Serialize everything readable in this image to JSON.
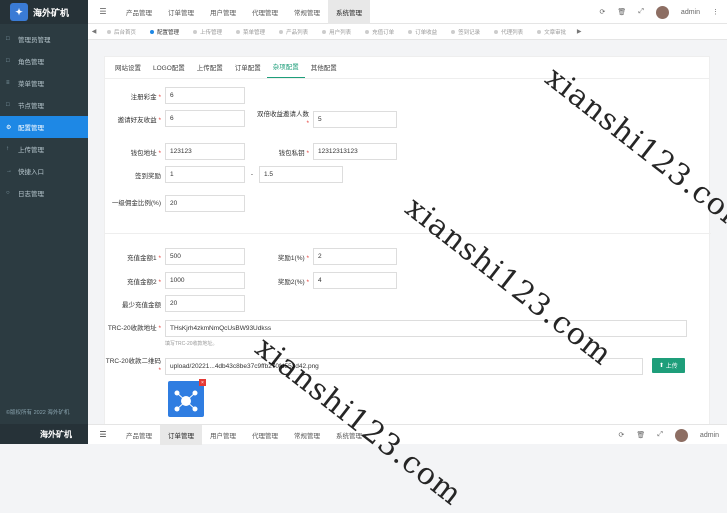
{
  "app": {
    "title": "海外矿机"
  },
  "sidebar": {
    "items": [
      {
        "icon": "□",
        "label": "管理员管理"
      },
      {
        "icon": "□",
        "label": "角色管理"
      },
      {
        "icon": "≡",
        "label": "菜单管理"
      },
      {
        "icon": "□",
        "label": "节点管理"
      },
      {
        "icon": "⚙",
        "label": "配置管理"
      },
      {
        "icon": "↑",
        "label": "上传管理"
      },
      {
        "icon": "→",
        "label": "快捷入口"
      },
      {
        "icon": "○",
        "label": "日志管理"
      }
    ],
    "active_index": 4,
    "copyright": "©版权所有 2022 海外矿机"
  },
  "topbar": {
    "tabs": [
      "产品管理",
      "订单管理",
      "用户管理",
      "代理管理",
      "常规管理",
      "系统管理"
    ],
    "active_index": 5,
    "user": "admin"
  },
  "page_tabs": [
    "后台首页",
    "配置管理",
    "上传管理",
    "菜单管理",
    "产品列表",
    "用户列表",
    "充值订单",
    "订单收益",
    "签到记录",
    "代理列表",
    "文章审批"
  ],
  "page_tabs_active": 1,
  "subtabs": [
    "网站设置",
    "LOGO配置",
    "上传配置",
    "订单配置",
    "杂项配置",
    "其他配置"
  ],
  "subtabs_active": 4,
  "form": {
    "register_bonus": {
      "label": "注册彩金",
      "value": "6"
    },
    "invite_income": {
      "label": "邀请好友收益",
      "value": "6"
    },
    "double_income_invites": {
      "label": "双倍收益邀请人数",
      "value": "5"
    },
    "wallet_address": {
      "label": "钱包地址",
      "value": "123123"
    },
    "wallet_key": {
      "label": "钱包私钥",
      "value": "12312313123"
    },
    "checkin_reward": {
      "label": "签到奖励",
      "min": "1",
      "sep": "-",
      "max": "1.5"
    },
    "level1_commission": {
      "label": "一级佣金比例(%)",
      "value": "20"
    },
    "recharge1": {
      "label": "充值金额1",
      "value": "500"
    },
    "reward1": {
      "label": "奖励1(%)",
      "value": "2"
    },
    "recharge2": {
      "label": "充值金额2",
      "value": "1000"
    },
    "reward2": {
      "label": "奖励2(%)",
      "value": "4"
    },
    "min_recharge": {
      "label": "最少充值金额",
      "value": "20"
    },
    "trc20_address": {
      "label": "TRC-20收款地址",
      "value": "THsKjrh4zkmNmQcUsBW93Udkss",
      "hint": "填写TRC-20收款地址。"
    },
    "trc20_qr": {
      "label": "TRC-20收款二维码",
      "value": "upload/20221...4db43c8be37c9ffb270fd553d42.png",
      "button": "上传"
    }
  },
  "watermark": "xianshi123.com",
  "colors": {
    "sidebar": "#2c3b41",
    "active": "#1e88e5",
    "accent": "#1e9e7a",
    "required": "#e53935"
  }
}
